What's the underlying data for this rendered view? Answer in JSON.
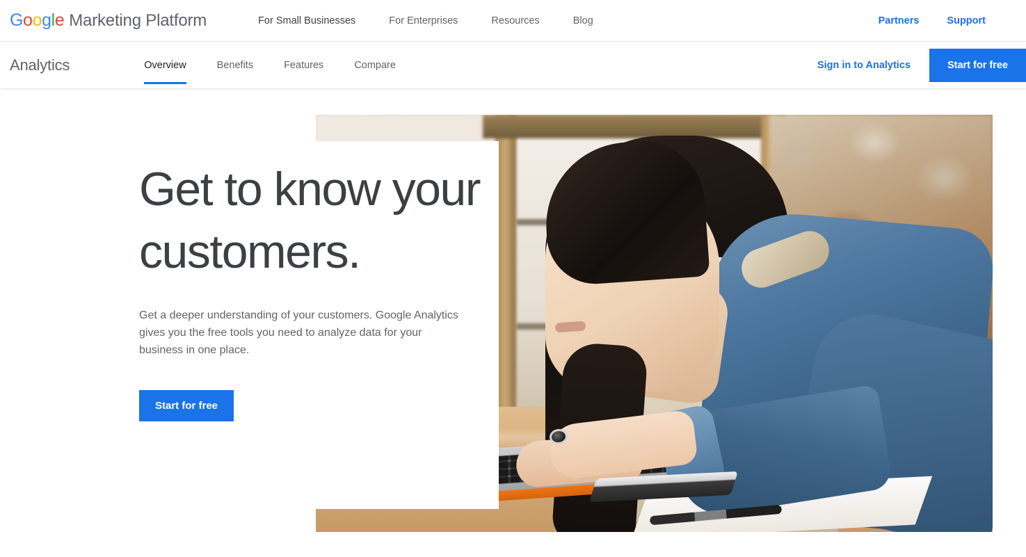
{
  "top_bar": {
    "logo": {
      "letters": [
        {
          "char": "G",
          "color": "#4285f4"
        },
        {
          "char": "o",
          "color": "#ea4335"
        },
        {
          "char": "o",
          "color": "#fbbc05"
        },
        {
          "char": "g",
          "color": "#4285f4"
        },
        {
          "char": "l",
          "color": "#34a853"
        },
        {
          "char": "e",
          "color": "#ea4335"
        }
      ],
      "suffix": "Marketing Platform"
    },
    "nav": [
      {
        "label": "For Small Businesses",
        "active": true
      },
      {
        "label": "For Enterprises",
        "active": false
      },
      {
        "label": "Resources",
        "active": false
      },
      {
        "label": "Blog",
        "active": false
      }
    ],
    "right_links": [
      {
        "label": "Partners"
      },
      {
        "label": "Support"
      }
    ]
  },
  "product_bar": {
    "title": "Analytics",
    "tabs": [
      {
        "label": "Overview",
        "active": true
      },
      {
        "label": "Benefits",
        "active": false
      },
      {
        "label": "Features",
        "active": false
      },
      {
        "label": "Compare",
        "active": false
      }
    ],
    "signin_label": "Sign in to Analytics",
    "cta_label": "Start for free"
  },
  "hero": {
    "heading": "Get to know your customers.",
    "subtext": "Get a deeper understanding of your customers. Google Analytics gives you the free tools you need to analyze data for your business in one place.",
    "cta_label": "Start for free",
    "image_alt": "Woman in denim shirt and apron typing on a laptop at a wooden desk in a shop"
  },
  "colors": {
    "accent_blue": "#1a73e8",
    "link_blue": "#1a73e8",
    "heading_gray": "#3c4043",
    "body_gray": "#5f6368",
    "background": "#ffffff"
  }
}
